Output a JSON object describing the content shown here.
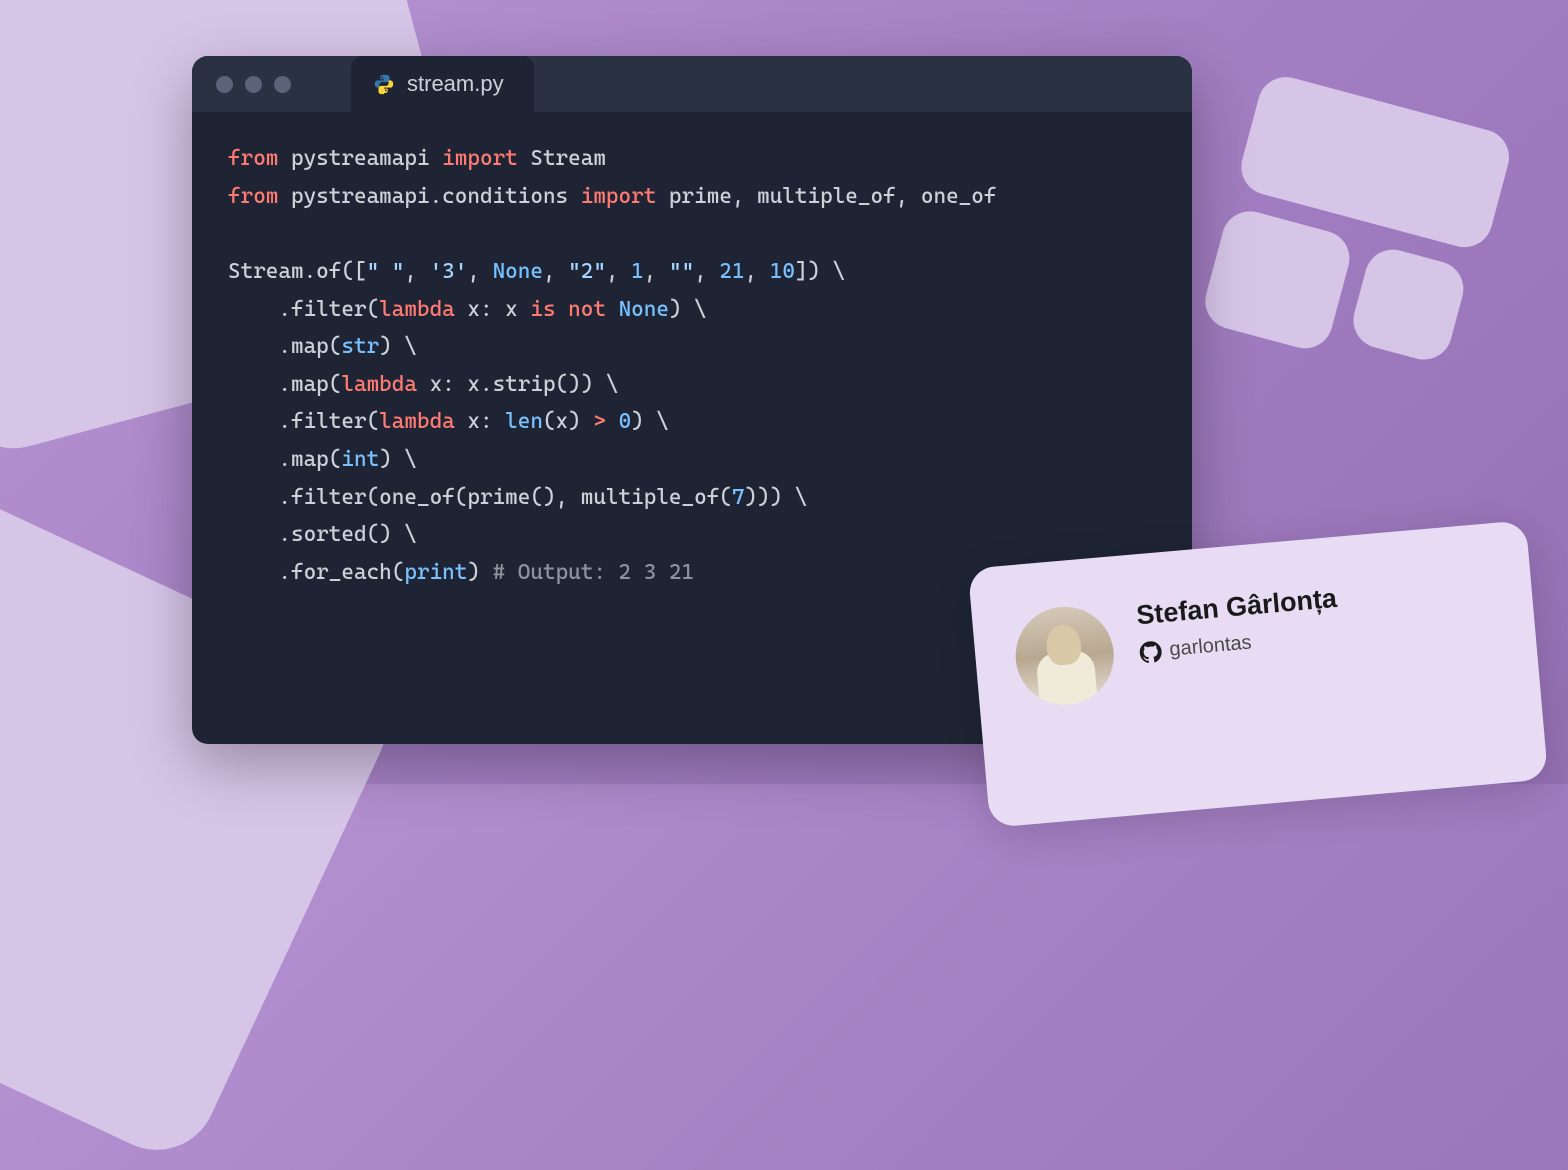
{
  "tab": {
    "title": "stream.py"
  },
  "code": {
    "line1": {
      "kw1": "from",
      "mod1": " pystreamapi ",
      "kw2": "import",
      "cls": " Stream"
    },
    "line2": {
      "kw1": "from",
      "mod1": " pystreamapi.conditions ",
      "kw2": "import",
      "imports": " prime, multiple_of, one_of"
    },
    "line4": {
      "pre": "Stream.of([",
      "s1": "\" \"",
      "c1": ", ",
      "s2": "'3'",
      "c2": ", ",
      "none": "None",
      "c3": ", ",
      "s3": "\"2\"",
      "c4": ", ",
      "n1": "1",
      "c5": ", ",
      "s4": "\"\"",
      "c6": ", ",
      "n2": "21",
      "c7": ", ",
      "n3": "10",
      "post": "]) \\"
    },
    "line5": {
      "pre": "    .filter(",
      "kw": "lambda",
      "mid1": " x: x ",
      "op1": "is",
      "sp1": " ",
      "op2": "not",
      "sp2": " ",
      "none": "None",
      "post": ") \\"
    },
    "line6": {
      "pre": "    .map(",
      "bi": "str",
      "post": ") \\"
    },
    "line7": {
      "pre": "    .map(",
      "kw": "lambda",
      "post": " x: x.strip()) \\"
    },
    "line8": {
      "pre": "    .filter(",
      "kw": "lambda",
      "mid": " x: ",
      "bi": "len",
      "mid2": "(x) ",
      "op": ">",
      "sp": " ",
      "num": "0",
      "post": ") \\"
    },
    "line9": {
      "pre": "    .map(",
      "bi": "int",
      "post": ") \\"
    },
    "line10": {
      "pre": "    .filter(one_of(prime(), multiple_of(",
      "num": "7",
      "post": "))) \\"
    },
    "line11": {
      "txt": "    .sorted() \\"
    },
    "line12": {
      "pre": "    .for_each(",
      "bi": "print",
      "mid": ") ",
      "comment": "# Output: 2 3 21"
    }
  },
  "author": {
    "name": "Stefan Gârlonța",
    "handle": "garlontas"
  }
}
